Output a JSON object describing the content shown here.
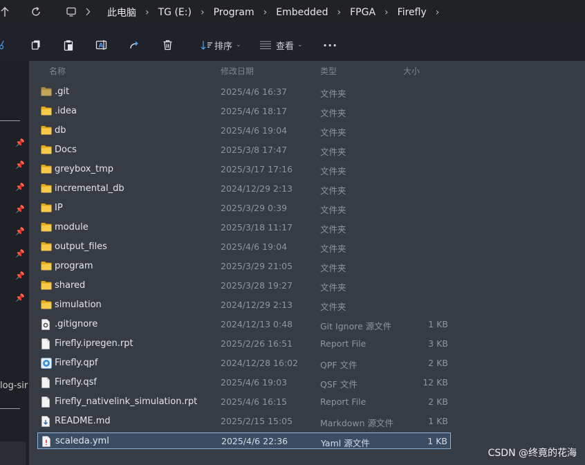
{
  "address": {
    "crumbs": [
      "此电脑",
      "TG (E:)",
      "Program",
      "Embedded",
      "FPGA",
      "Firefly"
    ]
  },
  "toolbar": {
    "sort_label": "排序",
    "view_label": "查看",
    "more_label": "···"
  },
  "sidebar": {
    "partial_text": "log-sir"
  },
  "columns": {
    "name": "名称",
    "date": "修改日期",
    "type": "类型",
    "size": "大小"
  },
  "files": [
    {
      "name": ".git",
      "date": "2025/4/6 16:37",
      "type": "文件夹",
      "size": "",
      "icon": "folder-dim-icon"
    },
    {
      "name": ".idea",
      "date": "2025/4/6 18:17",
      "type": "文件夹",
      "size": "",
      "icon": "folder-icon"
    },
    {
      "name": "db",
      "date": "2025/4/6 19:04",
      "type": "文件夹",
      "size": "",
      "icon": "folder-icon"
    },
    {
      "name": "Docs",
      "date": "2025/3/8 17:47",
      "type": "文件夹",
      "size": "",
      "icon": "folder-icon"
    },
    {
      "name": "greybox_tmp",
      "date": "2025/3/17 17:16",
      "type": "文件夹",
      "size": "",
      "icon": "folder-icon"
    },
    {
      "name": "incremental_db",
      "date": "2024/12/29 2:13",
      "type": "文件夹",
      "size": "",
      "icon": "folder-icon"
    },
    {
      "name": "IP",
      "date": "2025/3/29 0:39",
      "type": "文件夹",
      "size": "",
      "icon": "folder-icon"
    },
    {
      "name": "module",
      "date": "2025/3/18 11:17",
      "type": "文件夹",
      "size": "",
      "icon": "folder-icon"
    },
    {
      "name": "output_files",
      "date": "2025/4/6 19:04",
      "type": "文件夹",
      "size": "",
      "icon": "folder-icon"
    },
    {
      "name": "program",
      "date": "2025/3/29 21:05",
      "type": "文件夹",
      "size": "",
      "icon": "folder-icon"
    },
    {
      "name": "shared",
      "date": "2025/3/28 19:27",
      "type": "文件夹",
      "size": "",
      "icon": "folder-icon"
    },
    {
      "name": "simulation",
      "date": "2024/12/29 2:13",
      "type": "文件夹",
      "size": "",
      "icon": "folder-icon"
    },
    {
      "name": ".gitignore",
      "date": "2024/12/13 0:48",
      "type": "Git Ignore 源文件",
      "size": "1 KB",
      "icon": "gear-file-icon"
    },
    {
      "name": "Firefly.ipregen.rpt",
      "date": "2025/2/26 16:51",
      "type": "Report File",
      "size": "3 KB",
      "icon": "file-icon"
    },
    {
      "name": "Firefly.qpf",
      "date": "2024/12/28 16:02",
      "type": "QPF 文件",
      "size": "2 KB",
      "icon": "quartus-file-icon"
    },
    {
      "name": "Firefly.qsf",
      "date": "2025/4/6 19:03",
      "type": "QSF 文件",
      "size": "12 KB",
      "icon": "file-icon"
    },
    {
      "name": "Firefly_nativelink_simulation.rpt",
      "date": "2025/4/6 16:15",
      "type": "Report File",
      "size": "2 KB",
      "icon": "file-icon"
    },
    {
      "name": "README.md",
      "date": "2025/2/15 15:05",
      "type": "Markdown 源文件",
      "size": "1 KB",
      "icon": "markdown-file-icon"
    },
    {
      "name": "scaleda.yml",
      "date": "2025/4/6 22:36",
      "type": "Yaml 源文件",
      "size": "1 KB",
      "icon": "yaml-file-icon",
      "selected": true
    }
  ],
  "watermark": "CSDN @终竟的花海"
}
